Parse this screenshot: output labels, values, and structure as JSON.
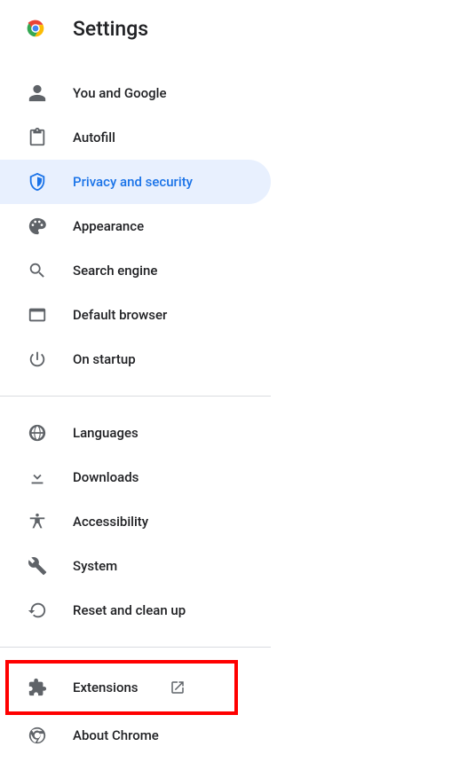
{
  "header": {
    "title": "Settings"
  },
  "menu": {
    "groups": [
      [
        {
          "icon": "person",
          "label": "You and Google",
          "selected": false
        },
        {
          "icon": "autofill",
          "label": "Autofill",
          "selected": false
        },
        {
          "icon": "shield",
          "label": "Privacy and security",
          "selected": true
        },
        {
          "icon": "palette",
          "label": "Appearance",
          "selected": false
        },
        {
          "icon": "search",
          "label": "Search engine",
          "selected": false
        },
        {
          "icon": "browser",
          "label": "Default browser",
          "selected": false
        },
        {
          "icon": "power",
          "label": "On startup",
          "selected": false
        }
      ],
      [
        {
          "icon": "globe",
          "label": "Languages",
          "selected": false
        },
        {
          "icon": "download",
          "label": "Downloads",
          "selected": false
        },
        {
          "icon": "accessibility",
          "label": "Accessibility",
          "selected": false
        },
        {
          "icon": "wrench",
          "label": "System",
          "selected": false
        },
        {
          "icon": "reset",
          "label": "Reset and clean up",
          "selected": false
        }
      ],
      [
        {
          "icon": "extension",
          "label": "Extensions",
          "selected": false,
          "external": true,
          "highlighted": true
        },
        {
          "icon": "chrome-outline",
          "label": "About Chrome",
          "selected": false
        }
      ]
    ]
  }
}
